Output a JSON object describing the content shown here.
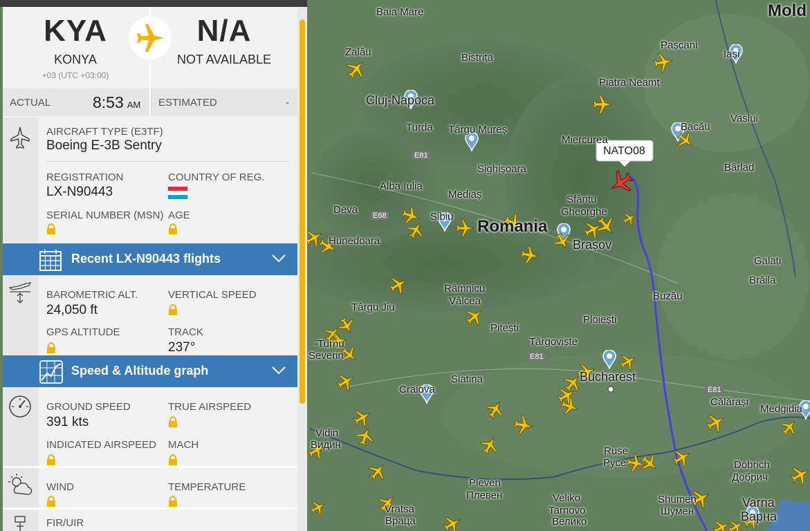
{
  "header": {
    "origin_code": "KYA",
    "origin_city": "KONYA",
    "origin_tz": "+03 (UTC +03:00)",
    "dest_code": "N/A",
    "dest_city": "NOT AVAILABLE"
  },
  "times": {
    "actual_label": "ACTUAL",
    "actual_time": "8:53",
    "actual_ampm": "AM",
    "estimated_label": "ESTIMATED",
    "estimated_value": "-"
  },
  "aircraft": {
    "type_label": "AIRCRAFT TYPE",
    "type_code": "(E3TF)",
    "type_value": "Boeing E-3B Sentry",
    "registration_label": "REGISTRATION",
    "registration_value": "LX-N90443",
    "country_label": "COUNTRY OF REG.",
    "serial_label": "SERIAL NUMBER (MSN)",
    "age_label": "AGE"
  },
  "recent_flights": {
    "title": "Recent LX-N90443 flights"
  },
  "altitude": {
    "baro_label": "BAROMETRIC ALT.",
    "baro_value": "24,050 ft",
    "vs_label": "VERTICAL SPEED",
    "gps_label": "GPS ALTITUDE",
    "track_label": "TRACK",
    "track_value": "237°"
  },
  "speed_graph": {
    "title": "Speed & Altitude graph"
  },
  "speed": {
    "gs_label": "GROUND SPEED",
    "gs_value": "391 kts",
    "tas_label": "TRUE AIRSPEED",
    "ias_label": "INDICATED AIRSPEED",
    "mach_label": "MACH"
  },
  "weather": {
    "wind_label": "WIND",
    "temp_label": "TEMPERATURE"
  },
  "fir": {
    "label": "FIR/UIR"
  },
  "map": {
    "callout": "NATO08",
    "labels": {
      "romania": "Romania",
      "baia_mare": "Baia Mare",
      "zalau": "Zalău",
      "bistrita": "Bistrița",
      "cluj": "Cluj-Napoca",
      "turda": "Turda",
      "targu_mures": "Târgu Mureș",
      "miercurea": "Miercurea",
      "sighisoara": "Sighișoara",
      "alba_iulia": "Alba Iulia",
      "medias": "Mediaș",
      "deva": "Deva",
      "sibiu": "Sibiu",
      "hunedoara": "Hunedoara",
      "sfantu": "Sfântu",
      "gheorghe": "Gheorghe",
      "brasov": "Brașov",
      "piatra": "Piatra Neamț",
      "pascani": "Pașcani",
      "iasi": "Iași",
      "bacau": "Bacău",
      "vaslui": "Vaslui",
      "barlad": "Bârlad",
      "galati": "Galați",
      "braila": "Brăila",
      "buzau": "Buzău",
      "ramnicu": "Râmnicu",
      "valcea": "Vâlcea",
      "targu_jiu": "Târgu Jiu",
      "pitesti": "Pitești",
      "ploiesti": "Ploiești",
      "targoviste": "Târgoviște",
      "bucharest": "Bucharest",
      "severin": "Severin",
      "turnu": "-Turnu",
      "craiova": "Craiova",
      "slatina": "Slatina",
      "calarasi": "Călărași",
      "medgidia": "Medgidia",
      "vidin": "Vidin",
      "vidin_bg": "Видин",
      "pleven": "Pleven",
      "pleven_bg": "Плевен",
      "ruse": "Ruse",
      "ruse_bg": "Русе",
      "veliko": "Veliko",
      "tarnovo": "Tarnovo",
      "tarnovo_bg": "Велико",
      "shumen": "Shumen",
      "shumen_bg": "Шумен",
      "dobrich": "Dobrich",
      "dobrich_bg": "Добрич",
      "varna": "Varna",
      "varna_bg": "Варна",
      "vratsa": "Vratsa",
      "vratsa_bg": "Враца",
      "moldova": "Mold",
      "e81a": "E81",
      "e68": "E68",
      "e81b": "E81",
      "e81c": "E81"
    }
  },
  "colors": {
    "accent_yellow": "#f5b400",
    "blue_bar": "#3a7ab8",
    "track_line": "#4a3fe0"
  }
}
